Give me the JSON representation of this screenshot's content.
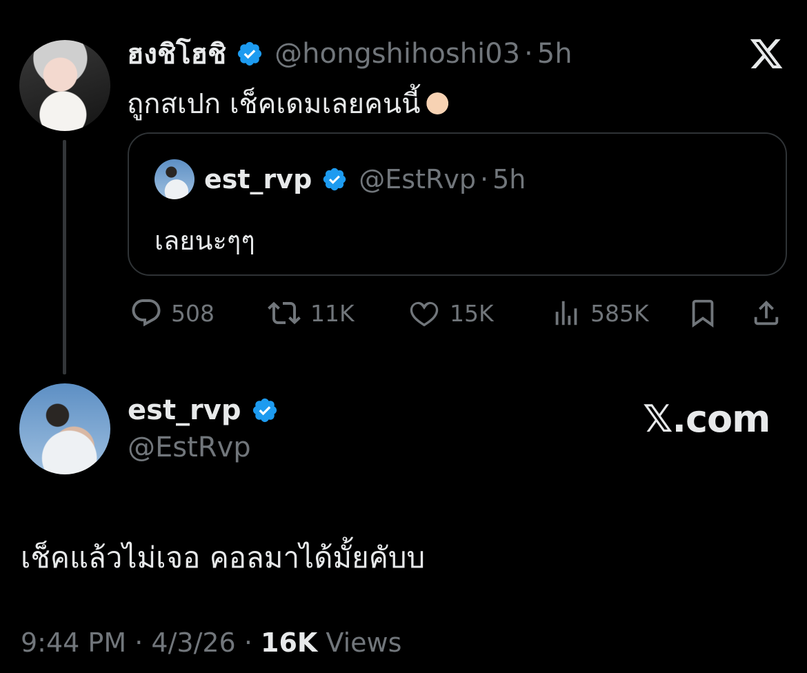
{
  "tweet1": {
    "display_name": "ฮงชิโฮชิ",
    "handle": "@hongshihoshi03",
    "dot": "·",
    "time": "5h",
    "text": "ถูกสเปก เช็คเดมเลยคนนี้",
    "quote": {
      "display_name": "est_rvp",
      "handle": "@EstRvp",
      "dot": "·",
      "time": "5h",
      "text": "เลยนะๆๆ"
    },
    "actions": {
      "replies": "508",
      "reposts": "11K",
      "likes": "15K",
      "views": "585K"
    }
  },
  "tweet2": {
    "display_name": "est_rvp",
    "handle": "@EstRvp",
    "text": "เช็คแล้วไม่เจอ คอลมาได้มั้ยคับบ",
    "time": "9:44 PM",
    "dot1": "·",
    "date": "4/3/26",
    "dot2": "·",
    "views_count": "16K",
    "views_label": "Views"
  },
  "brand": {
    "site_label": "𝕏.com"
  },
  "colors": {
    "background": "#000000",
    "text": "#e7e9ea",
    "muted": "#71767b",
    "verified": "#1d9bf0",
    "border": "#2f3336"
  },
  "icons": [
    "x-logo-icon",
    "verified-badge-icon",
    "reply-icon",
    "repost-icon",
    "like-icon",
    "views-icon",
    "bookmark-icon",
    "share-icon"
  ]
}
